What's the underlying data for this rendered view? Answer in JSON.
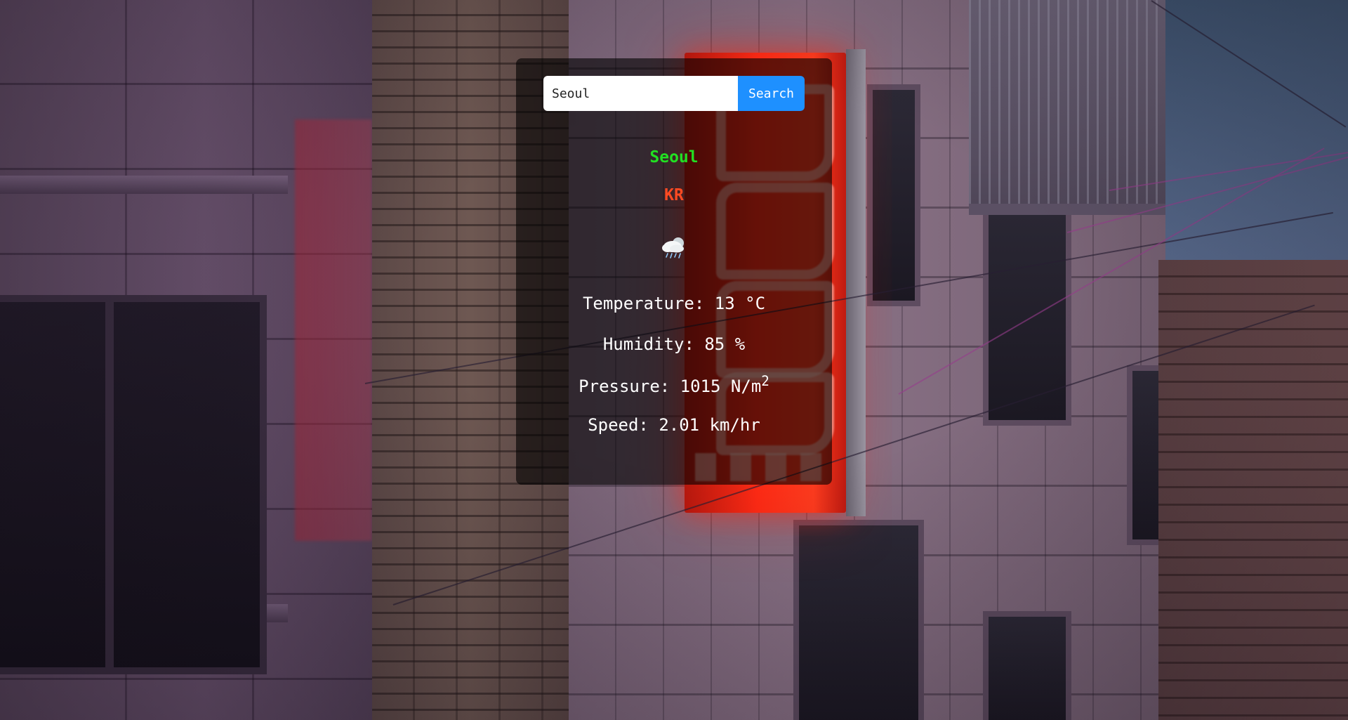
{
  "search": {
    "value": "Seoul",
    "placeholder": "",
    "button_label": "Search"
  },
  "location": {
    "city": "Seoul",
    "country": "KR"
  },
  "weather_icon": "rain-cloud-icon",
  "stats": {
    "temperature_label": "Temperature: ",
    "temperature_value": "13",
    "temperature_unit": " °C",
    "humidity_label": "Humidity: ",
    "humidity_value": "85",
    "humidity_unit": " %",
    "pressure_label": "Pressure: ",
    "pressure_value": "1015",
    "pressure_unit": " N/m",
    "pressure_unit_sup": "2",
    "speed_label": "Speed: ",
    "speed_value": "2.01",
    "speed_unit": " km/hr"
  },
  "colors": {
    "city": "#22e022",
    "country": "#ff4a22",
    "search_button": "#1e90ff",
    "card_background": "rgba(0,0,0,0.6)"
  }
}
